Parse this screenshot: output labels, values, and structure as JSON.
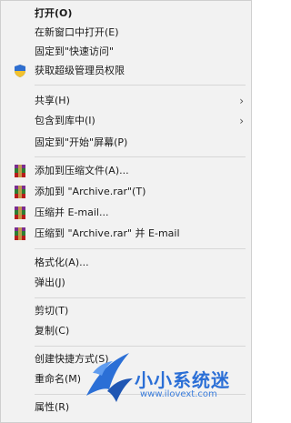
{
  "menu": {
    "items": [
      {
        "label": "打开(O)",
        "bold": true
      },
      {
        "label": "在新窗口中打开(E)"
      },
      {
        "label": "固定到\"快速访问\""
      },
      {
        "label": "获取超级管理员权限",
        "icon": "uac-shield-icon"
      },
      {
        "label": "共享(H)",
        "submenu": true
      },
      {
        "label": "包含到库中(I)",
        "submenu": true
      },
      {
        "label": "固定到\"开始\"屏幕(P)"
      },
      {
        "label": "添加到压缩文件(A)...",
        "icon": "winrar-icon"
      },
      {
        "label": "添加到 \"Archive.rar\"(T)",
        "icon": "winrar-icon"
      },
      {
        "label": "压缩并 E-mail...",
        "icon": "winrar-icon"
      },
      {
        "label": "压缩到 \"Archive.rar\" 并 E-mail",
        "icon": "winrar-icon"
      },
      {
        "label": "格式化(A)..."
      },
      {
        "label": "弹出(J)"
      },
      {
        "label": "剪切(T)"
      },
      {
        "label": "复制(C)"
      },
      {
        "label": "创建快捷方式(S)"
      },
      {
        "label": "重命名(M)"
      },
      {
        "label": "属性(R)"
      }
    ],
    "submenu_arrow": "›"
  },
  "watermark": {
    "brand": "小小系统迷",
    "url": "www.ilovext.com",
    "accent": "#2b6fd6"
  }
}
